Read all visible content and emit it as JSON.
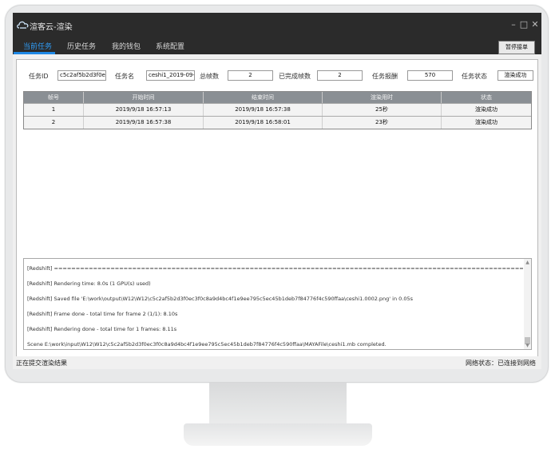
{
  "window": {
    "title": "渲客云-渲染",
    "controls": [
      "–",
      "□",
      "✕"
    ]
  },
  "nav": {
    "tabs": [
      {
        "label": "当前任务",
        "active": true
      },
      {
        "label": "历史任务",
        "active": false
      },
      {
        "label": "我的钱包",
        "active": false
      },
      {
        "label": "系统配置",
        "active": false
      }
    ],
    "pause_label": "暂停接单"
  },
  "task": {
    "id_label": "任务ID",
    "id_value": "c5c2af5b2d3f0ec",
    "name_label": "任务名",
    "name_value": "ceshi1_2019-09-",
    "total_frames_label": "总帧数",
    "total_frames_value": "2",
    "done_frames_label": "已完成帧数",
    "done_frames_value": "2",
    "reward_label": "任务报酬",
    "reward_value": "570",
    "status_label": "任务状态",
    "status_value": "渲染成功"
  },
  "table": {
    "headers": [
      "帧号",
      "开始时间",
      "结束时间",
      "渲染用时",
      "状态"
    ],
    "rows": [
      [
        "1",
        "2019/9/18 16:57:13",
        "2019/9/18 16:57:38",
        "25秒",
        "渲染成功"
      ],
      [
        "2",
        "2019/9/18 16:57:38",
        "2019/9/18 16:58:01",
        "23秒",
        "渲染成功"
      ]
    ]
  },
  "log": {
    "lines": [
      "[Redshift] ================================================================================================================",
      "[Redshift] Rendering time: 8.0s (1 GPU(s) used)",
      "[Redshift] Saved file 'E:\\work\\output\\W12\\W12\\c5c2af5b2d3f0ec3f0c8a9d4bc4f1e9ee795c5ec45b1deb7f84776f4c590ffaa\\ceshi1.0002.png' in 0.05s",
      "[Redshift] Frame done - total time for frame 2 (1/1): 8.10s",
      "[Redshift] Rendering done - total time for 1 frames: 8.11s",
      "Scene E:\\work\\input\\W12\\W12\\c5c2af5b2d3f0ec3f0c8a9d4bc4f1e9ee795c5ec45b1deb7f84776f4c590ffaa\\MAYAFile\\ceshi1.mb completed."
    ]
  },
  "status": {
    "left": "正在提交渲染结果",
    "network": "网络状态：已连接到网络"
  }
}
